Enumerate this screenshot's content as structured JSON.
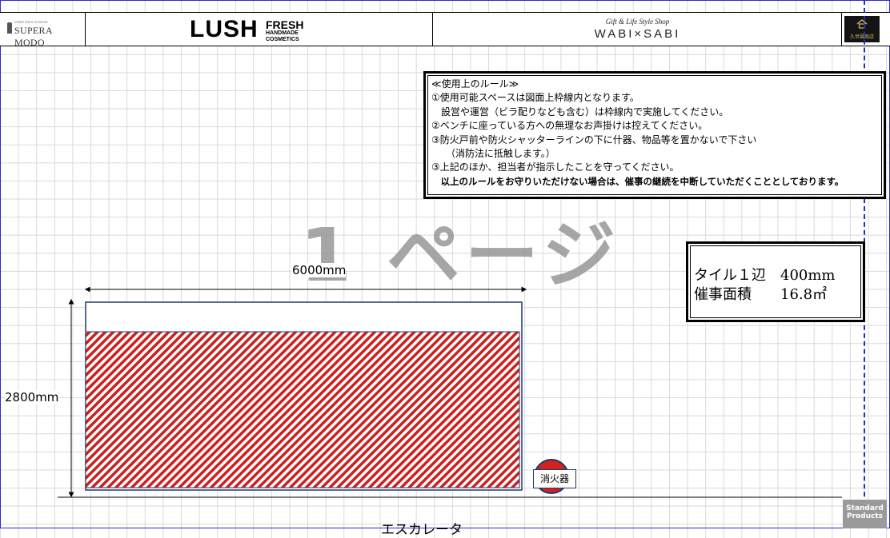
{
  "header": {
    "supera_sub": "select store universe",
    "supera_name": "SUPERA MODO",
    "lush_name": "LUSH",
    "lush_fresh": "FRESH",
    "lush_tagline_1": "HANDMADE",
    "lush_tagline_2": "COSMETICS",
    "wabi_tagline": "Gift & Life Style Shop",
    "wabi_name": "WABI×SABI",
    "kuze_name": "久世福商店"
  },
  "rules": {
    "title": "≪使用上のルール≫",
    "lines": [
      "①使用可能スペースは図面上枠線内となります。",
      "　設営や運営（ビラ配りなども含む）は枠線内で実施してください。",
      "②ベンチに座っている方への無理なお声掛けは控えてください。",
      "③防火戸前や防火シャッターラインの下に什器、物品等を置かないで下さい",
      "　　（消防法に抵触します。）",
      "③上記のほか、担当者が指示したことを守ってください。"
    ],
    "warning": "　以上のルールをお守りいただけない場合は、催事の継続を中断していただくこととしております。"
  },
  "info": {
    "tile_label": "タイル１辺",
    "tile_value": "400mm",
    "area_label": "催事面積",
    "area_value": "16.8㎡"
  },
  "watermark": "1 ページ",
  "diagram": {
    "width_label": "6000mm",
    "height_label": "2800mm",
    "extinguisher_label": "消火器",
    "escalator_label": "エスカレータ"
  },
  "badge": {
    "line1": "Standard",
    "line2": "Products"
  },
  "colors": {
    "hatch_red": "#cc1f1f",
    "booth_border": "#1f3a68",
    "dashed_line": "#1f2fbf",
    "extinguisher_red": "#d61f1f"
  }
}
